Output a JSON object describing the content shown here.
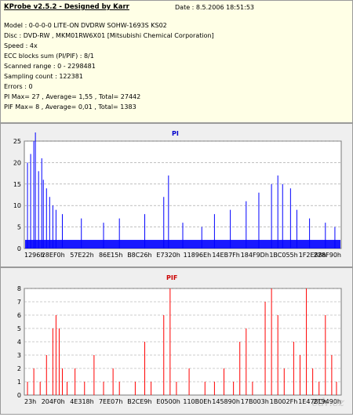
{
  "header": {
    "title": "KProbe v2.5.2 - Designed by Karr",
    "date": "Date : 8.5.2006 18:51:53"
  },
  "info_lines": [
    "Model : 0-0-0-0 LITE-ON DVDRW SOHW-1693S KS02",
    "Disc : DVD-RW , MKM01RW6X01 [Mitsubishi Chemical Corporation]",
    "Speed : 4x",
    "ECC blocks sum (PI/PIF) : 8/1",
    "Scanned range : 0 - 2298481",
    "Sampling count : 122381",
    "Errors : 0",
    "PI Max= 27 , Average= 1,55 , Total= 27442",
    "PIF Max= 8 , Average= 0,01 , Total= 1383"
  ],
  "watermark": "cdr.cz",
  "chart_data": [
    {
      "type": "bar",
      "title": "PI",
      "color": "#0000ff",
      "ylim": [
        0,
        25
      ],
      "yticks": [
        0,
        5,
        10,
        15,
        20,
        25
      ],
      "xtick_labels": [
        "1296h",
        "28EF0h",
        "57E22h",
        "86E15h",
        "B8C26h",
        "E7320h",
        "11896Eh",
        "14EB7Fh",
        "184F9Dh",
        "1BC055h",
        "1F2E88h",
        "228F90h"
      ],
      "baseline_level": 2,
      "spikes": [
        {
          "x": 0.01,
          "y": 20
        },
        {
          "x": 0.02,
          "y": 22
        },
        {
          "x": 0.03,
          "y": 25
        },
        {
          "x": 0.035,
          "y": 27
        },
        {
          "x": 0.045,
          "y": 18
        },
        {
          "x": 0.055,
          "y": 21
        },
        {
          "x": 0.06,
          "y": 16
        },
        {
          "x": 0.07,
          "y": 14
        },
        {
          "x": 0.08,
          "y": 12
        },
        {
          "x": 0.09,
          "y": 10
        },
        {
          "x": 0.1,
          "y": 9
        },
        {
          "x": 0.12,
          "y": 8
        },
        {
          "x": 0.18,
          "y": 7
        },
        {
          "x": 0.25,
          "y": 6
        },
        {
          "x": 0.3,
          "y": 7
        },
        {
          "x": 0.38,
          "y": 8
        },
        {
          "x": 0.44,
          "y": 12
        },
        {
          "x": 0.455,
          "y": 17
        },
        {
          "x": 0.5,
          "y": 6
        },
        {
          "x": 0.56,
          "y": 5
        },
        {
          "x": 0.6,
          "y": 8
        },
        {
          "x": 0.65,
          "y": 9
        },
        {
          "x": 0.7,
          "y": 11
        },
        {
          "x": 0.74,
          "y": 13
        },
        {
          "x": 0.78,
          "y": 15
        },
        {
          "x": 0.8,
          "y": 17
        },
        {
          "x": 0.815,
          "y": 15
        },
        {
          "x": 0.84,
          "y": 14
        },
        {
          "x": 0.86,
          "y": 9
        },
        {
          "x": 0.9,
          "y": 7
        },
        {
          "x": 0.95,
          "y": 6
        },
        {
          "x": 0.98,
          "y": 5
        }
      ]
    },
    {
      "type": "bar",
      "title": "PIF",
      "color": "#ff0000",
      "ylim": [
        0,
        8
      ],
      "yticks": [
        0,
        1,
        2,
        3,
        4,
        5,
        6,
        7,
        8
      ],
      "xtick_labels": [
        "23h",
        "204F0h",
        "4E318h",
        "7EE07h",
        "B2CE9h",
        "E0500h",
        "110B0Eh",
        "145890h",
        "17B003h",
        "1B002Fh",
        "1E478Ch",
        "219490h"
      ],
      "spikes": [
        {
          "x": 0.01,
          "y": 1
        },
        {
          "x": 0.03,
          "y": 2
        },
        {
          "x": 0.05,
          "y": 1
        },
        {
          "x": 0.07,
          "y": 3
        },
        {
          "x": 0.09,
          "y": 5
        },
        {
          "x": 0.1,
          "y": 6
        },
        {
          "x": 0.11,
          "y": 5
        },
        {
          "x": 0.12,
          "y": 2
        },
        {
          "x": 0.135,
          "y": 1
        },
        {
          "x": 0.16,
          "y": 2
        },
        {
          "x": 0.19,
          "y": 1
        },
        {
          "x": 0.22,
          "y": 3
        },
        {
          "x": 0.25,
          "y": 1
        },
        {
          "x": 0.28,
          "y": 2
        },
        {
          "x": 0.3,
          "y": 1
        },
        {
          "x": 0.35,
          "y": 1
        },
        {
          "x": 0.38,
          "y": 4
        },
        {
          "x": 0.4,
          "y": 1
        },
        {
          "x": 0.44,
          "y": 6
        },
        {
          "x": 0.46,
          "y": 8
        },
        {
          "x": 0.48,
          "y": 1
        },
        {
          "x": 0.52,
          "y": 2
        },
        {
          "x": 0.57,
          "y": 1
        },
        {
          "x": 0.6,
          "y": 1
        },
        {
          "x": 0.63,
          "y": 2
        },
        {
          "x": 0.66,
          "y": 1
        },
        {
          "x": 0.68,
          "y": 4
        },
        {
          "x": 0.7,
          "y": 5
        },
        {
          "x": 0.72,
          "y": 1
        },
        {
          "x": 0.76,
          "y": 7
        },
        {
          "x": 0.78,
          "y": 8
        },
        {
          "x": 0.8,
          "y": 6
        },
        {
          "x": 0.82,
          "y": 2
        },
        {
          "x": 0.85,
          "y": 4
        },
        {
          "x": 0.87,
          "y": 3
        },
        {
          "x": 0.89,
          "y": 8
        },
        {
          "x": 0.91,
          "y": 2
        },
        {
          "x": 0.93,
          "y": 1
        },
        {
          "x": 0.95,
          "y": 6
        },
        {
          "x": 0.97,
          "y": 3
        },
        {
          "x": 0.985,
          "y": 1
        }
      ]
    }
  ]
}
